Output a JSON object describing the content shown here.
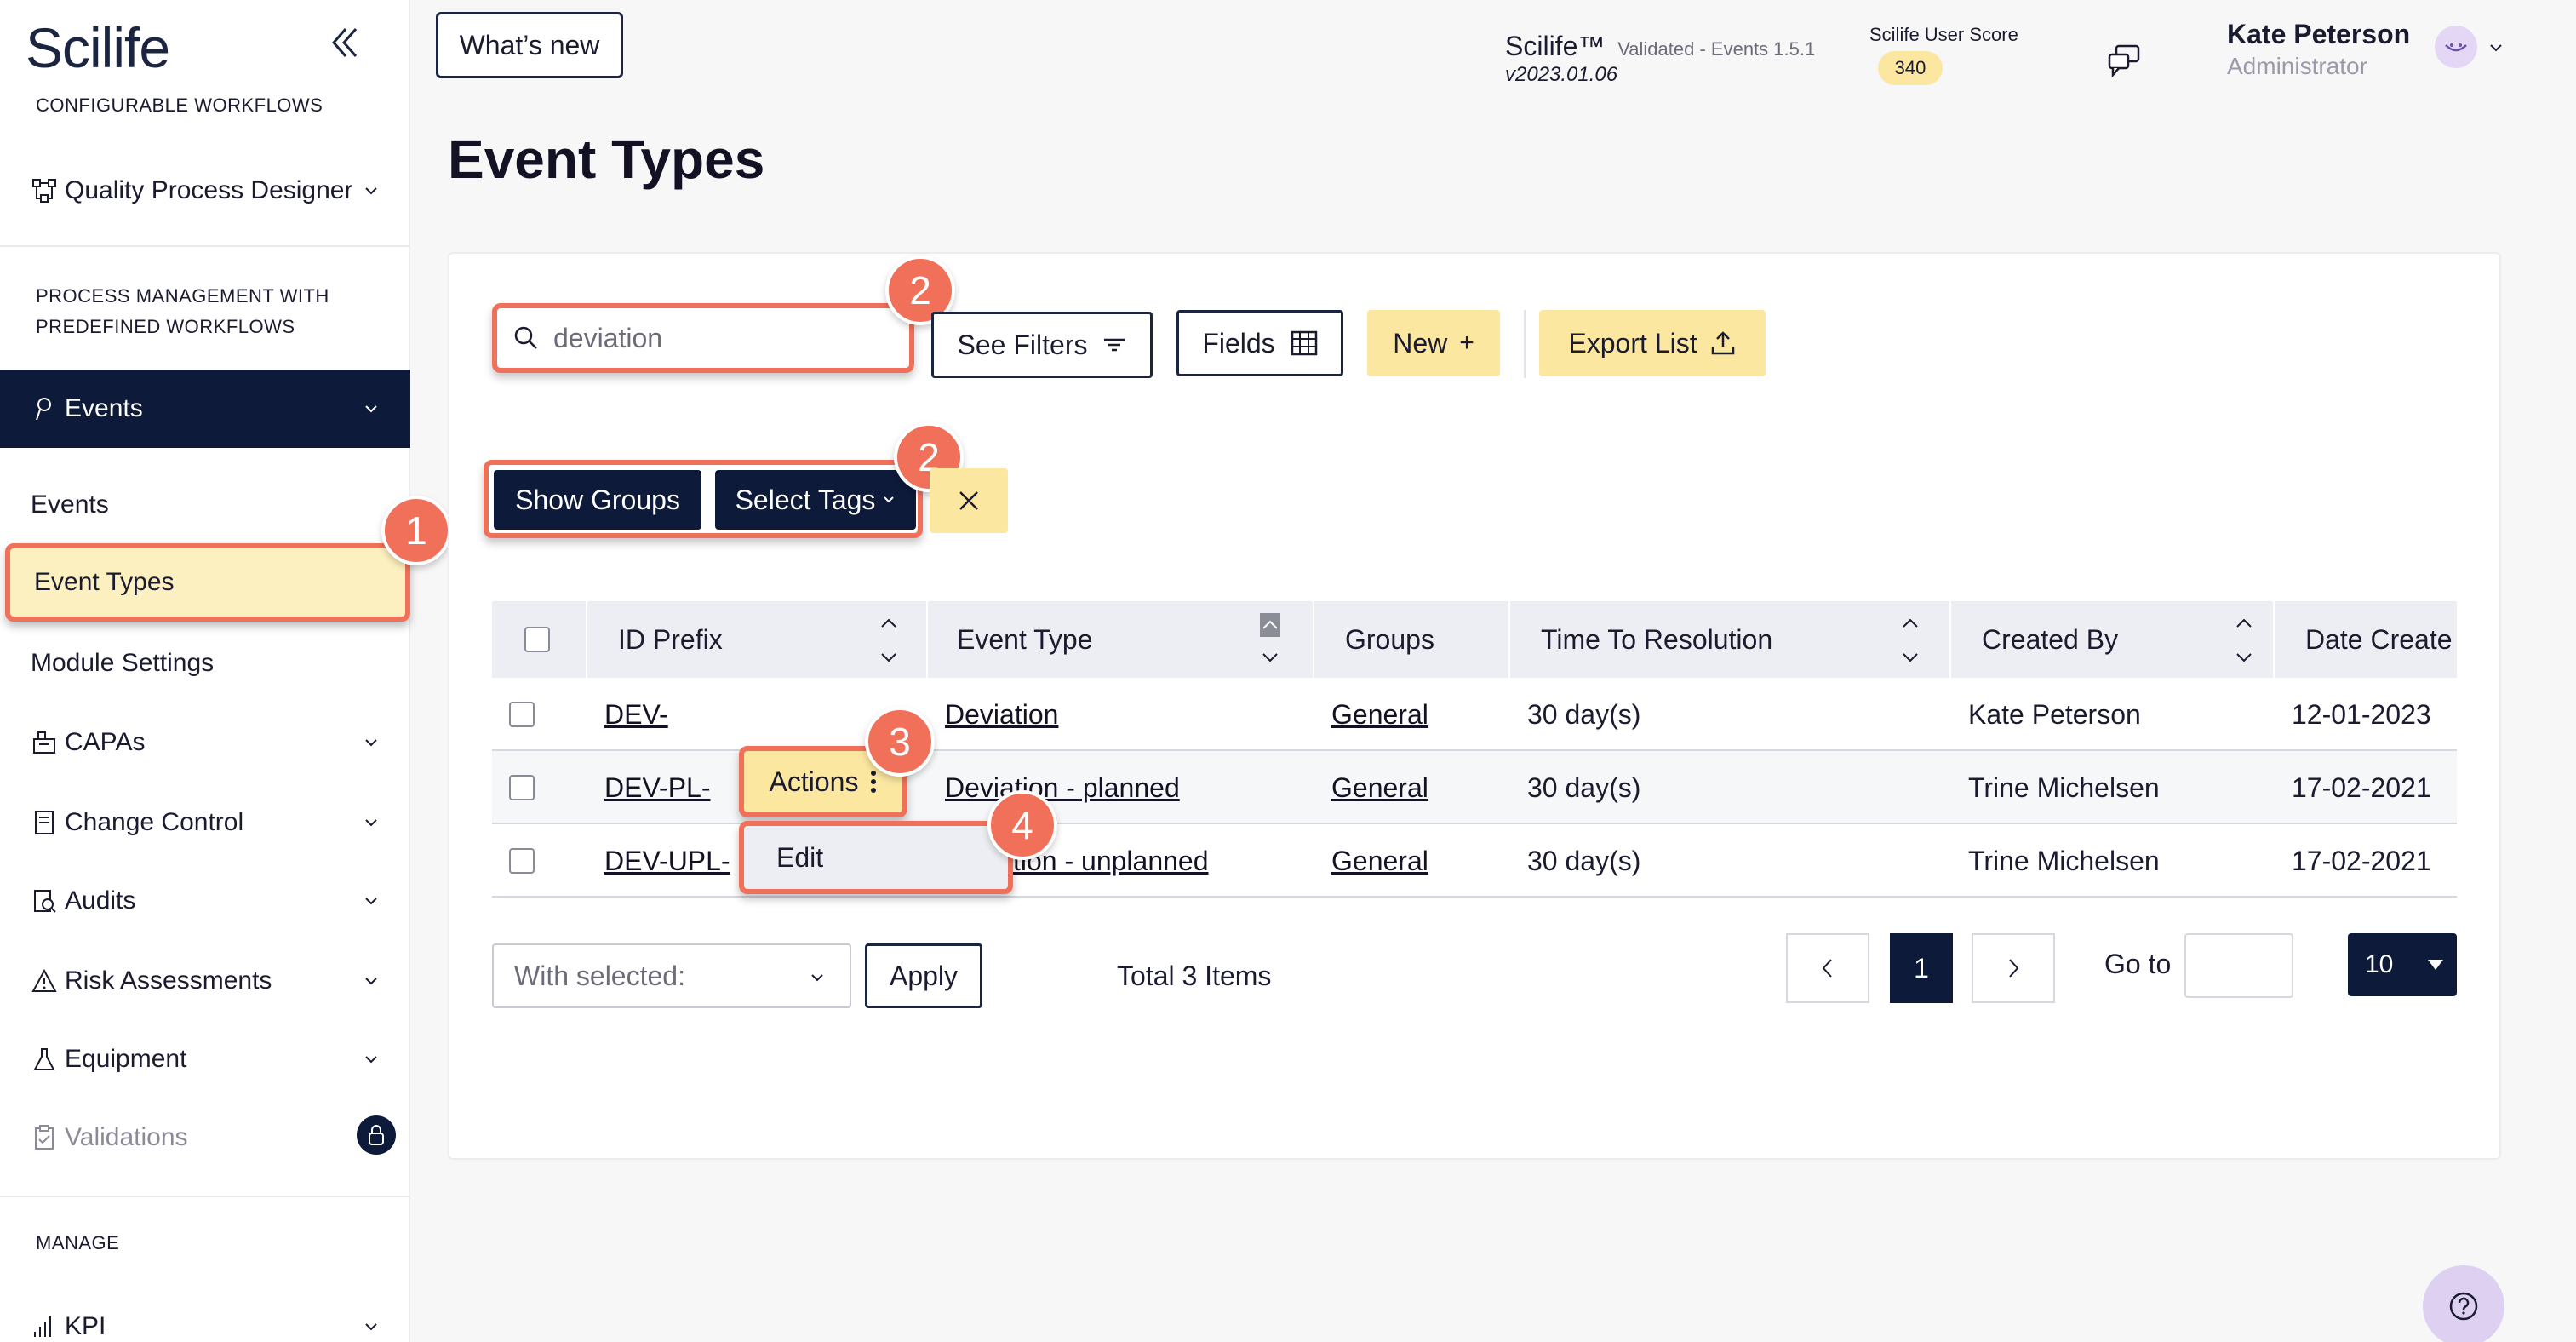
{
  "sidebar": {
    "logo": "Scilife",
    "section_configurable": "CONFIGURABLE WORKFLOWS",
    "quality_process_designer": "Quality Process Designer",
    "section_process_line1": "PROCESS MANAGEMENT WITH",
    "section_process_line2": "PREDEFINED WORKFLOWS",
    "events": "Events",
    "sub_events": "Events",
    "sub_event_types": "Event Types",
    "sub_module_settings": "Module Settings",
    "capas": "CAPAs",
    "change_control": "Change Control",
    "audits": "Audits",
    "risk_assessments": "Risk Assessments",
    "equipment": "Equipment",
    "validations": "Validations",
    "section_manage": "MANAGE",
    "kpi": "KPI"
  },
  "header": {
    "whats_new": "What’s new",
    "brand": "Scilife™",
    "brand_validated": "Validated - Events 1.5.1",
    "version": "v2023.01.06",
    "score_label": "Scilife User Score",
    "score_value": "340",
    "user_name": "Kate Peterson",
    "user_role": "Administrator"
  },
  "page": {
    "title": "Event Types"
  },
  "toolbar": {
    "search_value": "deviation",
    "see_filters": "See Filters",
    "fields": "Fields",
    "new": "New",
    "export_list": "Export List",
    "show_groups": "Show Groups",
    "select_tags": "Select Tags"
  },
  "table": {
    "headers": {
      "id_prefix": "ID Prefix",
      "event_type": "Event Type",
      "groups": "Groups",
      "time_to_resolution": "Time To Resolution",
      "created_by": "Created By",
      "date_created": "Date Create"
    },
    "rows": [
      {
        "id_prefix": "DEV-",
        "event_type": "Deviation",
        "groups": "General",
        "ttr": "30 day(s)",
        "created_by": "Kate Peterson",
        "date": "12-01-2023"
      },
      {
        "id_prefix": "DEV-PL-",
        "event_type": "Deviation - planned",
        "groups": "General",
        "ttr": "30 day(s)",
        "created_by": "Trine Michelsen",
        "date": "17-02-2021"
      },
      {
        "id_prefix": "DEV-UPL-",
        "event_type": "tion - unplanned",
        "groups": "General",
        "ttr": "30 day(s)",
        "created_by": "Trine Michelsen",
        "date": "17-02-2021"
      }
    ],
    "actions_label": "Actions",
    "edit_label": "Edit"
  },
  "footer": {
    "with_selected": "With selected:",
    "apply": "Apply",
    "total": "Total 3 Items",
    "current_page": "1",
    "go_to": "Go to",
    "page_size": "10"
  },
  "badges": {
    "b1": "1",
    "b2a": "2",
    "b2b": "2",
    "b3": "3",
    "b4": "4"
  },
  "colors": {
    "navy": "#0d1a3a",
    "yellow": "#fbe7a0",
    "highlight": "#f0705a"
  }
}
